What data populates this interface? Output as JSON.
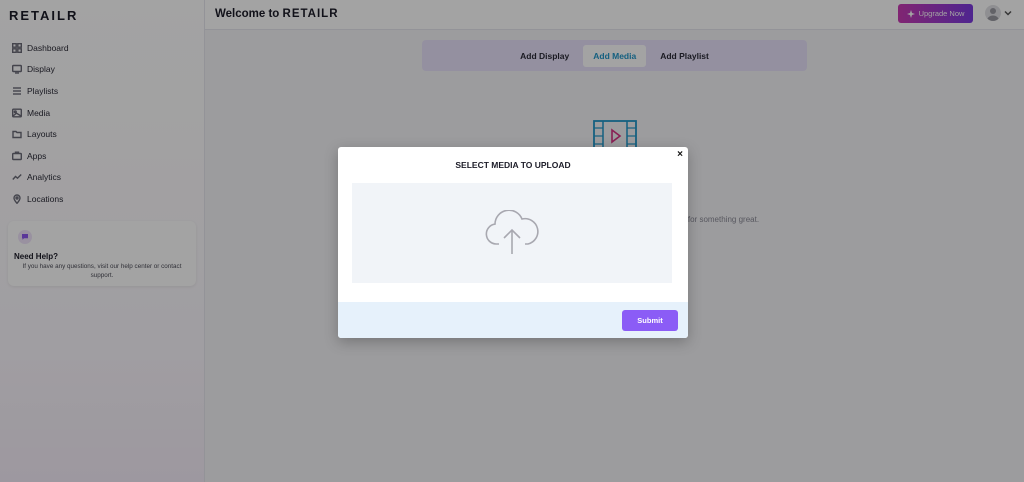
{
  "brand": {
    "logo": "RETAILR"
  },
  "sidebar": {
    "items": [
      {
        "label": "Dashboard",
        "icon": "grid-icon"
      },
      {
        "label": "Display",
        "icon": "monitor-icon"
      },
      {
        "label": "Playlists",
        "icon": "list-icon"
      },
      {
        "label": "Media",
        "icon": "image-icon"
      },
      {
        "label": "Layouts",
        "icon": "folder-icon"
      },
      {
        "label": "Apps",
        "icon": "apps-icon"
      },
      {
        "label": "Analytics",
        "icon": "trend-icon"
      },
      {
        "label": "Locations",
        "icon": "pin-icon"
      }
    ],
    "help": {
      "title": "Need Help?",
      "text": "If you have any questions, visit our help center or contact support."
    }
  },
  "header": {
    "welcome": "Welcome to",
    "brand": "RETAILR",
    "upgrade_label": "Upgrade Now"
  },
  "tabs": [
    {
      "label": "Add Display",
      "active": false
    },
    {
      "label": "Add Media",
      "active": true
    },
    {
      "label": "Add Playlist",
      "active": false
    }
  ],
  "empty_state": {
    "text_fragment": "m for something great."
  },
  "modal": {
    "title": "SELECT MEDIA TO UPLOAD",
    "close_label": "×",
    "submit_label": "Submit"
  },
  "colors": {
    "accent": "#8b5cf6",
    "active_tab_text": "#2196c9",
    "upgrade_gradient_start": "#c93bb3",
    "upgrade_gradient_end": "#7b3ae0"
  }
}
